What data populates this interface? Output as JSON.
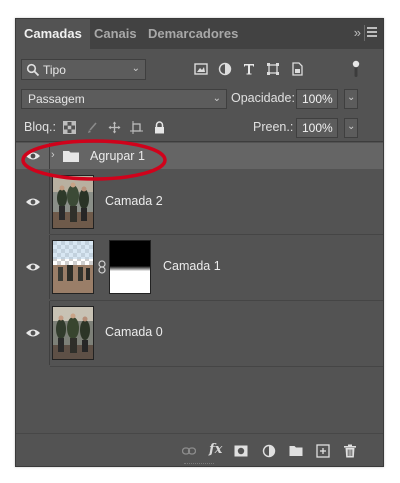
{
  "tabs": [
    {
      "label": "Camadas",
      "active": true
    },
    {
      "label": "Canais",
      "active": false
    },
    {
      "label": "Demarcadores",
      "active": false
    }
  ],
  "tab_bar": {
    "collapse_icon": "double-chevron-right-icon",
    "menu_icon": "hamburger-menu-icon"
  },
  "filter": {
    "kind_label": "Tipo",
    "icons": [
      "image-filter-icon",
      "adjustment-filter-icon",
      "type-filter-icon",
      "shape-filter-icon",
      "smart-object-filter-icon"
    ],
    "toggle_icon": "filter-toggle-icon"
  },
  "blend": {
    "mode": "Passagem",
    "opacity_label": "Opacidade:",
    "opacity_value": "100%"
  },
  "lock": {
    "label": "Bloq.:",
    "icons": [
      "lock-transparent-icon",
      "lock-paint-icon",
      "lock-move-icon",
      "lock-artboard-icon",
      "lock-all-icon"
    ],
    "fill_label": "Preen.:",
    "fill_value": "100%"
  },
  "layers": [
    {
      "name": "Agrupar 1",
      "kind": "group",
      "visible": true,
      "expanded": false,
      "selected": true
    },
    {
      "name": "Camada 2",
      "kind": "pixel",
      "visible": true
    },
    {
      "name": "Camada 1",
      "kind": "pixel-with-mask",
      "visible": true
    },
    {
      "name": "Camada 0",
      "kind": "pixel",
      "visible": true
    }
  ],
  "footer": {
    "icons": [
      "link-layers-icon",
      "fx-icon",
      "add-mask-icon",
      "adjustment-layer-icon",
      "new-group-icon",
      "new-layer-icon",
      "delete-icon"
    ],
    "fx_label": "fx"
  },
  "colors": {
    "panel_bg": "#535353",
    "tabbar_bg": "#424242",
    "selected_row": "#656565",
    "annotation": "#d0021b"
  }
}
